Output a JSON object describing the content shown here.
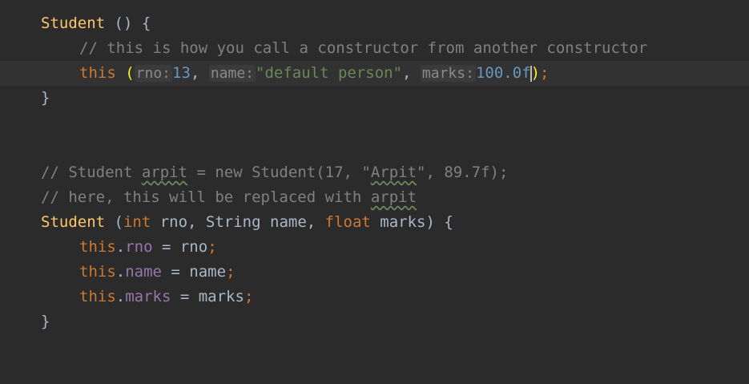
{
  "editor": {
    "lines": [
      {
        "kind": "ctor1",
        "name": "Student",
        "rest": " () {"
      },
      {
        "kind": "comment",
        "text": "// this is how you call a constructor from another constructor"
      },
      {
        "kind": "call",
        "keyword": "this",
        "open": "(",
        "hint_rno": "rno:",
        "val_rno": "13",
        "sep1": ", ",
        "hint_name": "name:",
        "val_name": "\"default person\"",
        "sep2": ", ",
        "hint_marks": "marks:",
        "val_marks_a": "100.0f",
        "close": ")",
        "semi": ";"
      },
      {
        "kind": "close",
        "text": "}"
      },
      {
        "kind": "comment2a",
        "p1": "// Student ",
        "w1": "arpit",
        "p2": " = new Student(17, \"",
        "w2": "Arpit",
        "p3": "\", 89.7f);"
      },
      {
        "kind": "comment2b",
        "p1": "// here, this will be replaced with ",
        "w1": "arpit"
      },
      {
        "kind": "ctor2",
        "name": "Student",
        "p1": " (",
        "int": "int",
        "p2": " rno, String name, ",
        "float": "float",
        "p3": " marks) {"
      },
      {
        "kind": "assign",
        "this": "this",
        "dot": ".",
        "field": "rno",
        "rhs": " = rno",
        "semi": ";"
      },
      {
        "kind": "assign",
        "this": "this",
        "dot": ".",
        "field": "name",
        "rhs": " = name",
        "semi": ";"
      },
      {
        "kind": "assign",
        "this": "this",
        "dot": ".",
        "field": "marks",
        "rhs": " = marks",
        "semi": ";"
      },
      {
        "kind": "close",
        "text": "}"
      }
    ]
  }
}
